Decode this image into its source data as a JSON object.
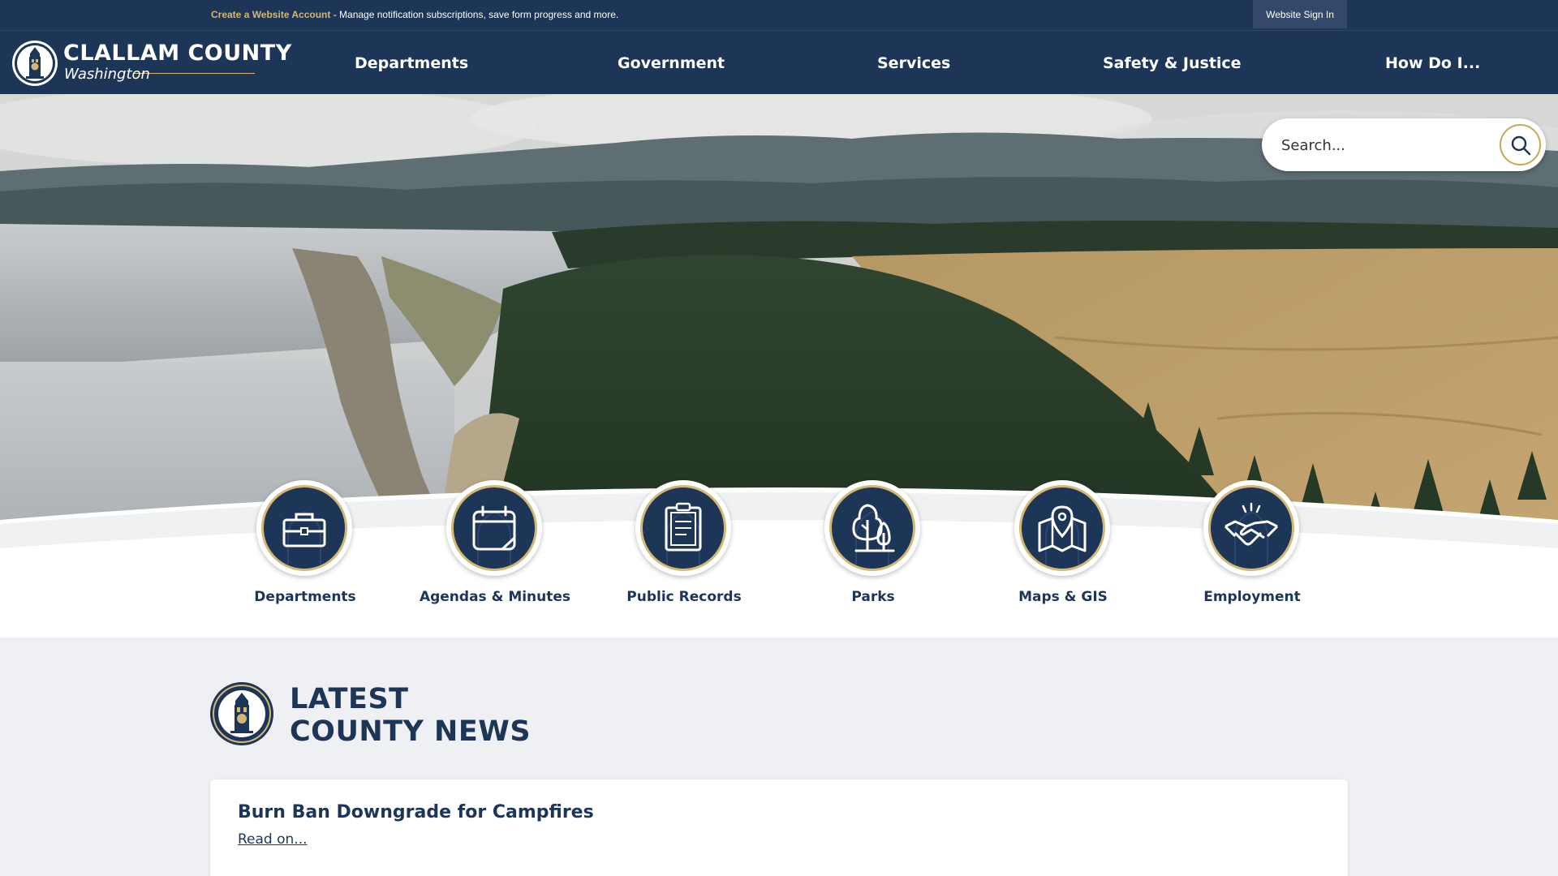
{
  "topbar": {
    "create_account_link": "Create a Website Account",
    "message": " - Manage notification subscriptions, save form progress and more.",
    "sign_in_label": "Website Sign In"
  },
  "logo": {
    "name": "CLALLAM COUNTY",
    "state": "Washington"
  },
  "nav": {
    "items": [
      {
        "label": "Departments"
      },
      {
        "label": "Government"
      },
      {
        "label": "Services"
      },
      {
        "label": "Safety & Justice"
      },
      {
        "label": "How Do I..."
      }
    ]
  },
  "search": {
    "placeholder": "Search..."
  },
  "quick_links": [
    {
      "label": "Departments",
      "icon": "briefcase-icon"
    },
    {
      "label": "Agendas & Minutes",
      "icon": "calendar-icon"
    },
    {
      "label": "Public Records",
      "icon": "clipboard-icon"
    },
    {
      "label": "Parks",
      "icon": "trees-icon"
    },
    {
      "label": "Maps & GIS",
      "icon": "map-pin-icon"
    },
    {
      "label": "Employment",
      "icon": "handshake-icon"
    }
  ],
  "news": {
    "heading_line1": "LATEST",
    "heading_line2": "COUNTY NEWS",
    "items": [
      {
        "title": "Burn Ban Downgrade for Campfires",
        "link_label": "Read on..."
      }
    ]
  },
  "colors": {
    "navy": "#1d3557",
    "gold": "#d2b874",
    "page_bg": "#eef0f3"
  }
}
